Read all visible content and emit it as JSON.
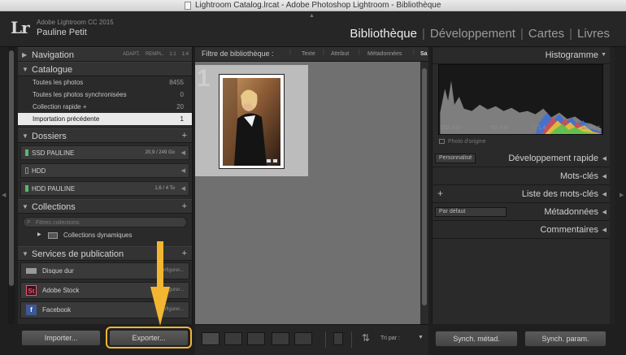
{
  "window": {
    "title": "Lightroom Catalog.lrcat - Adobe Photoshop Lightroom - Bibliothèque"
  },
  "identity": {
    "logo": "Lr",
    "app_version": "Adobe Lightroom CC 2015",
    "user": "Pauline Petit"
  },
  "modules": [
    {
      "label": "Bibliothèque",
      "active": true
    },
    {
      "label": "Développement",
      "active": false
    },
    {
      "label": "Cartes",
      "active": false
    },
    {
      "label": "Livres",
      "active": false
    }
  ],
  "module_separator": "|",
  "left_panel": {
    "navigation": {
      "label": "Navigation",
      "options": [
        "ADAPT.",
        "REMPL.",
        "1:1",
        "1:4"
      ]
    },
    "catalogue": {
      "label": "Catalogue",
      "items": [
        {
          "label": "Toutes les photos",
          "count": "8455"
        },
        {
          "label": "Toutes les photos synchronisées",
          "count": "0"
        },
        {
          "label": "Collection rapide +",
          "count": "20"
        },
        {
          "label": "Importation précédente",
          "count": "1",
          "selected": true
        }
      ]
    },
    "dossiers": {
      "label": "Dossiers",
      "plus": "+",
      "items": [
        {
          "label": "SSD PAULINE",
          "capacity": "20,9 / 249 Go",
          "online": true
        },
        {
          "label": "HDD",
          "capacity": "",
          "online": false
        },
        {
          "label": "HDD PAULINE",
          "capacity": "1,6 / 4 To",
          "online": true
        }
      ]
    },
    "collections": {
      "label": "Collections",
      "plus": "+",
      "search_placeholder": "Filtres collections",
      "items": [
        {
          "label": "Collections dynamiques"
        }
      ]
    },
    "publish": {
      "label": "Services de publication",
      "plus": "+",
      "items": [
        {
          "label": "Disque dur",
          "action": "Configurer...",
          "icon": "hard-disk-icon"
        },
        {
          "label": "Adobe Stock",
          "action": "Configurer...",
          "icon": "adobe-stock-icon",
          "icon_text": "St"
        },
        {
          "label": "Facebook",
          "action": "Configurer...",
          "icon": "facebook-icon",
          "icon_text": "f"
        }
      ]
    },
    "buttons": {
      "import": "Importer...",
      "export": "Exporter..."
    }
  },
  "filter_bar": {
    "title": "Filtre de bibliothèque :",
    "tabs": [
      "Texte",
      "Attribut",
      "Métadonnées",
      "Sa"
    ]
  },
  "grid": {
    "cell_index": "1"
  },
  "toolbar": {
    "sort_label": "Tri par :"
  },
  "right_panel": {
    "histogram": {
      "label": "Histogramme",
      "iso": "ISO 100",
      "focal": "85 mm",
      "aperture": "f / 1,4",
      "shutter": "1/640 s",
      "original_label": "Photo d'origine"
    },
    "quick_develop": {
      "label": "Développement rapide",
      "preset": "Personnalisé"
    },
    "keywords": {
      "label": "Mots-clés"
    },
    "keyword_list": {
      "label": "Liste des mots-clés",
      "plus": "+"
    },
    "metadata": {
      "label": "Métadonnées",
      "preset": "Par défaut"
    },
    "comments": {
      "label": "Commentaires"
    },
    "buttons": {
      "sync_metadata": "Synch. métad.",
      "sync_settings": "Synch. param."
    }
  },
  "colors": {
    "highlight": "#f2b632",
    "panel_bg": "#2a2a2a",
    "grid_bg": "#707070"
  }
}
